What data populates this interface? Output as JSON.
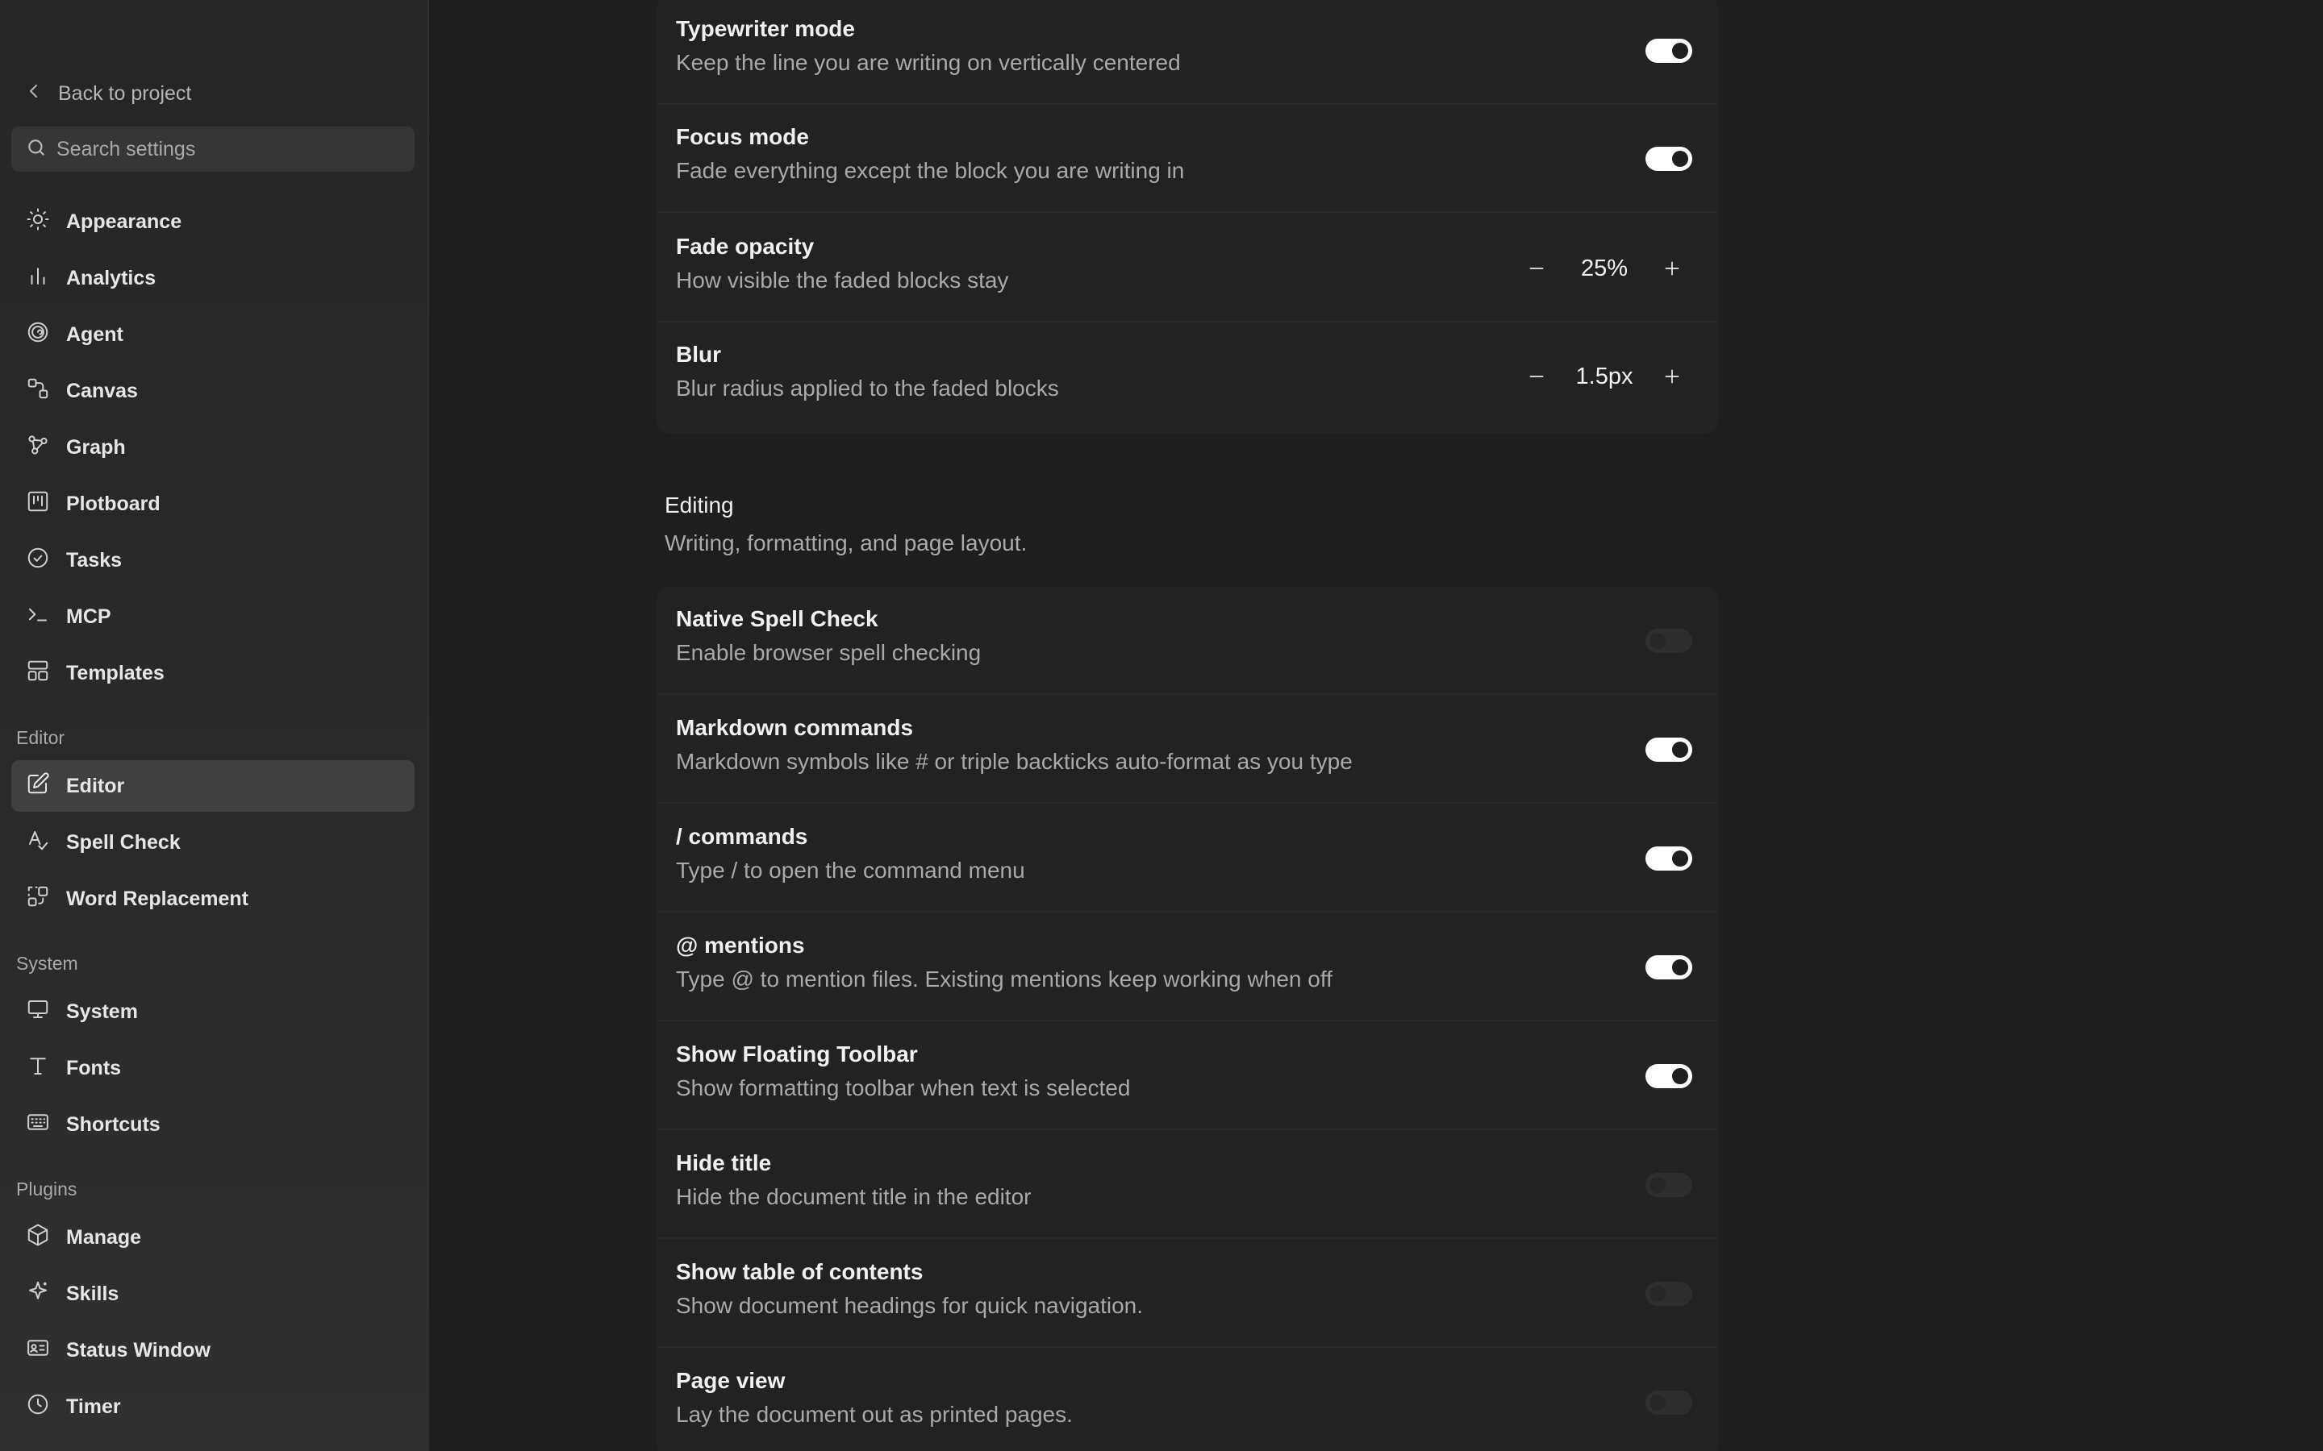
{
  "sidebar": {
    "back_label": "Back to project",
    "search_placeholder": "Search settings",
    "items": [
      {
        "label": "Appearance",
        "icon": "sun-icon"
      },
      {
        "label": "Analytics",
        "icon": "bar-chart-icon"
      },
      {
        "label": "Agent",
        "icon": "spiral-icon"
      },
      {
        "label": "Canvas",
        "icon": "canvas-icon"
      },
      {
        "label": "Graph",
        "icon": "graph-icon"
      },
      {
        "label": "Plotboard",
        "icon": "plotboard-icon"
      },
      {
        "label": "Tasks",
        "icon": "check-circle-icon"
      },
      {
        "label": "MCP",
        "icon": "terminal-icon"
      },
      {
        "label": "Templates",
        "icon": "layout-icon"
      }
    ],
    "editor_section": "Editor",
    "editor_items": [
      {
        "label": "Editor",
        "icon": "edit-icon",
        "active": true
      },
      {
        "label": "Spell Check",
        "icon": "spell-check-icon"
      },
      {
        "label": "Word Replacement",
        "icon": "replace-icon"
      }
    ],
    "system_section": "System",
    "system_items": [
      {
        "label": "System",
        "icon": "monitor-icon"
      },
      {
        "label": "Fonts",
        "icon": "type-icon"
      },
      {
        "label": "Shortcuts",
        "icon": "keyboard-icon"
      }
    ],
    "plugins_section": "Plugins",
    "plugins_items": [
      {
        "label": "Manage",
        "icon": "package-icon"
      },
      {
        "label": "Skills",
        "icon": "sparkle-icon"
      },
      {
        "label": "Status Window",
        "icon": "id-card-icon"
      },
      {
        "label": "Timer",
        "icon": "clock-icon"
      }
    ]
  },
  "focus_card": {
    "rows": [
      {
        "title": "Typewriter mode",
        "desc": "Keep the line you are writing on vertically centered",
        "control": "toggle",
        "on": true
      },
      {
        "title": "Focus mode",
        "desc": "Fade everything except the block you are writing in",
        "control": "toggle",
        "on": true
      },
      {
        "title": "Fade opacity",
        "desc": "How visible the faded blocks stay",
        "control": "stepper",
        "value": "25%"
      },
      {
        "title": "Blur",
        "desc": "Blur radius applied to the faded blocks",
        "control": "stepper",
        "value": "1.5px"
      }
    ]
  },
  "editing": {
    "title": "Editing",
    "desc": "Writing, formatting, and page layout.",
    "rows": [
      {
        "title": "Native Spell Check",
        "desc": "Enable browser spell checking",
        "on": false
      },
      {
        "title": "Markdown commands",
        "desc": "Markdown symbols like # or triple backticks auto-format as you type",
        "on": true
      },
      {
        "title": "/ commands",
        "desc": "Type / to open the command menu",
        "on": true
      },
      {
        "title": "@ mentions",
        "desc": "Type @ to mention files. Existing mentions keep working when off",
        "on": true
      },
      {
        "title": "Show Floating Toolbar",
        "desc": "Show formatting toolbar when text is selected",
        "on": true
      },
      {
        "title": "Hide title",
        "desc": "Hide the document title in the editor",
        "on": false
      },
      {
        "title": "Show table of contents",
        "desc": "Show document headings for quick navigation.",
        "on": false
      },
      {
        "title": "Page view",
        "desc": "Lay the document out as printed pages.",
        "on": false
      }
    ]
  }
}
